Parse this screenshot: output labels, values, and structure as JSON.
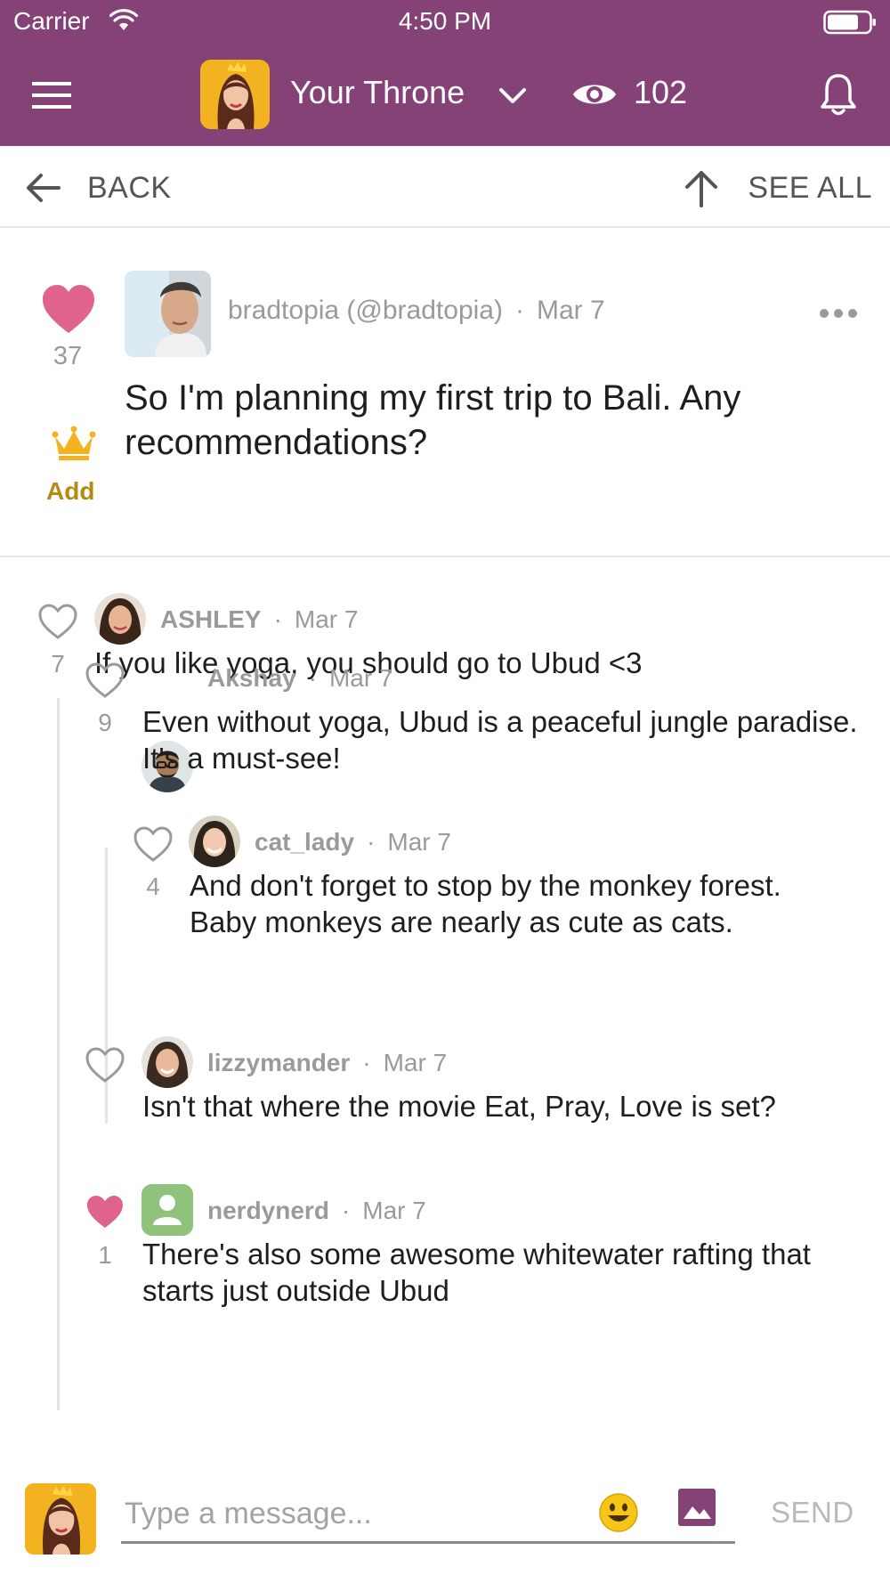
{
  "status_bar": {
    "carrier": "Carrier",
    "time": "4:50 PM"
  },
  "header": {
    "title": "Your Throne",
    "views": "102",
    "icons": [
      "menu-icon",
      "chevron-down-icon",
      "eye-icon",
      "bell-icon"
    ],
    "background_color": "#844277"
  },
  "nav": {
    "back_label": "BACK",
    "see_all_label": "SEE ALL"
  },
  "post": {
    "author": "bradtopia (@bradtopia)",
    "date": "Mar 7",
    "likes": "37",
    "liked": true,
    "text": "So I'm planning my first trip to Bali. Any recommendations?",
    "add_label": "Add"
  },
  "comments": [
    {
      "author": "ASHLEY",
      "date": "Mar 7",
      "likes": "7",
      "liked": false,
      "depth": 0,
      "text": "If you like yoga, you should go to Ubud <3"
    },
    {
      "author": "Akshay",
      "date": "Mar 7",
      "likes": "9",
      "liked": false,
      "depth": 1,
      "text": "Even without yoga, Ubud is a peaceful jungle paradise. It's a must-see!"
    },
    {
      "author": "cat_lady",
      "date": "Mar 7",
      "likes": "4",
      "liked": false,
      "depth": 2,
      "text": "And don't forget to stop by the monkey forest. Baby monkeys are nearly as cute as cats."
    },
    {
      "author": "lizzymander",
      "date": "Mar 7",
      "likes": "",
      "liked": false,
      "depth": 1,
      "text": "Isn't that where the movie Eat, Pray, Love is set?"
    },
    {
      "author": "nerdynerd",
      "date": "Mar 7",
      "likes": "1",
      "liked": true,
      "depth": 1,
      "text": "There's also some awesome whitewater rafting that starts just outside Ubud"
    }
  ],
  "composer": {
    "placeholder": "Type a message...",
    "send_label": "SEND"
  },
  "colors": {
    "accent": "#844277",
    "heart": "#e0638d",
    "crown": "#f3b21f",
    "muted": "#9a9a9a"
  }
}
